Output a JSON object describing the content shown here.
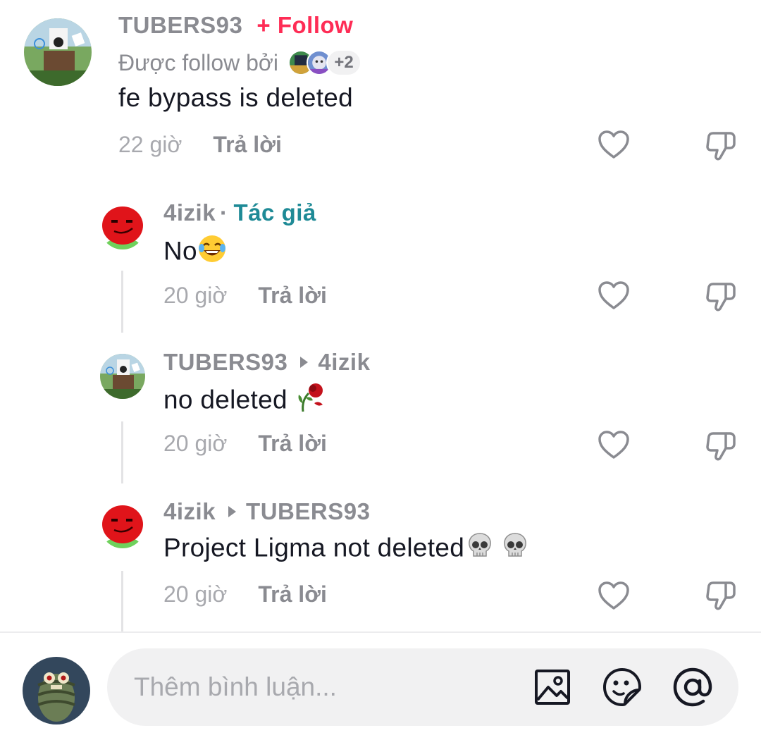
{
  "comments": [
    {
      "username": "TUBERS93",
      "follow_label": "+ Follow",
      "followed_by_text": "Được follow bởi",
      "followed_by_more": "+2",
      "text": "fe bypass is deleted",
      "time": "22 giờ",
      "reply_label": "Trả lời"
    }
  ],
  "replies": [
    {
      "username": "4izik",
      "separator": "·",
      "author_tag": "Tác giả",
      "text": "No",
      "emoji": "face-with-tears-of-joy",
      "time": "20 giờ",
      "reply_label": "Trả lời"
    },
    {
      "username": "TUBERS93",
      "reply_to": "4izik",
      "text": "no deleted ",
      "emoji": "wilted-flower",
      "time": "20 giờ",
      "reply_label": "Trả lời"
    },
    {
      "username": "4izik",
      "reply_to": "TUBERS93",
      "text": "Project Ligma not deleted",
      "emoji": "skull",
      "time": "20 giờ",
      "reply_label": "Trả lời"
    }
  ],
  "composer": {
    "placeholder": "Thêm bình luận...",
    "icons": [
      "image-icon",
      "sticker-icon",
      "mention-icon"
    ]
  },
  "colors": {
    "follow": "#fe2c55",
    "author_tag": "#1e8a96",
    "muted_text": "#8a8b91",
    "timestamp": "#a8a9ae",
    "primary_text": "#161823",
    "input_bg": "#f1f1f2"
  }
}
